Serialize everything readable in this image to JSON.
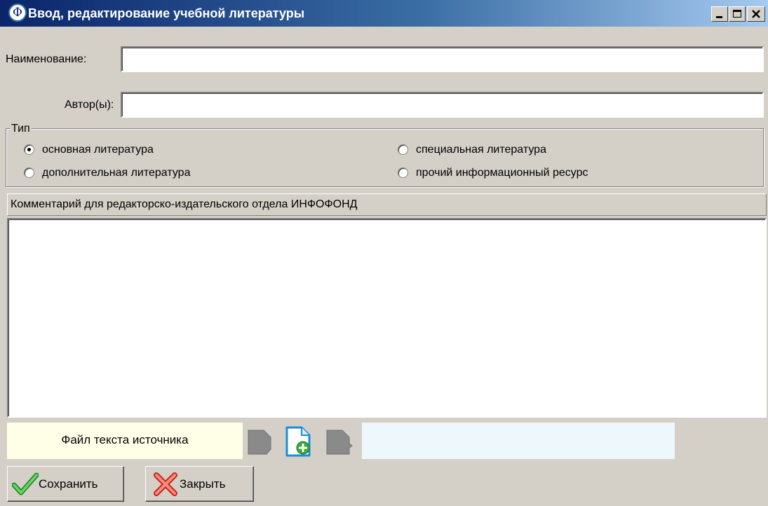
{
  "window": {
    "title": "Ввод, редактирование учебной литературы",
    "app_icon_glyph": "Φ"
  },
  "form": {
    "name_label": "Наименование:",
    "name_value": "",
    "author_label": "Автор(ы):",
    "author_value": ""
  },
  "type_group": {
    "legend": "Тип",
    "options": [
      {
        "label": "основная литература",
        "selected": true
      },
      {
        "label": "специальная литература",
        "selected": false
      },
      {
        "label": "дополнительная литература",
        "selected": false
      },
      {
        "label": "прочий информационный ресурс",
        "selected": false
      }
    ]
  },
  "comment": {
    "label": "Комментарий для редакторско-издательского  отдела ИНФОФОНД",
    "value": ""
  },
  "file_panel": {
    "label": "Файл текста источника",
    "icons": [
      "file-disabled-icon",
      "add-file-icon",
      "remove-file-disabled-icon"
    ]
  },
  "buttons": {
    "save": "Сохранить",
    "close": "Закрыть"
  },
  "colors": {
    "title_start": "#0a246a",
    "title_end": "#a6caf0",
    "file_label_bg": "#ffffe8",
    "file_area_bg": "#eef7fc",
    "save_icon": "#2fae2f",
    "close_icon": "#e8413c"
  }
}
